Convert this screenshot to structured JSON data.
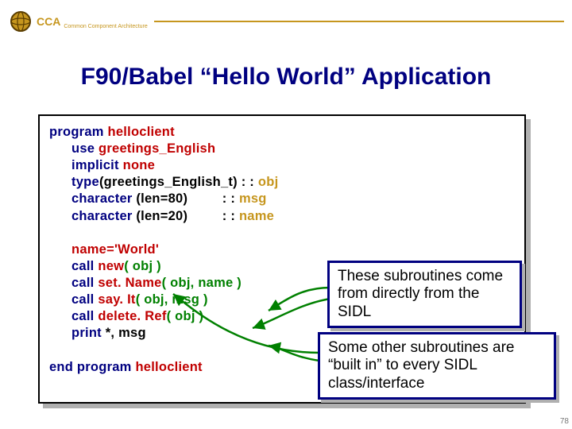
{
  "header": {
    "abbrev": "CCA",
    "subtitle": "Common Component Architecture"
  },
  "title": "F90/Babel  “Hello World” Application",
  "code": {
    "l1": {
      "kw": "program",
      "id": "helloclient"
    },
    "l2": {
      "kw": "use",
      "id": "greetings_English"
    },
    "l3": {
      "kw": "implicit",
      "id": "none"
    },
    "l4": {
      "kw": "type",
      "p1": "(greetings_English_t)",
      "sep": " : :",
      "ty": "obj"
    },
    "l5": {
      "kw": "character",
      "p1": "(len=80)",
      "sep": " : :",
      "ty": "msg"
    },
    "l6": {
      "kw": "character",
      "p1": "(len=20)",
      "sep": " : :",
      "ty": "name"
    },
    "l7": {
      "id": "name='World'"
    },
    "l8": {
      "kw": "call",
      "fn": "new",
      "args": "( obj )"
    },
    "l9": {
      "kw": "call",
      "fn": "set. Name",
      "args": "( obj, name )"
    },
    "l10": {
      "kw": "call",
      "fn": "say. It",
      "args": "( obj, msg )"
    },
    "l11": {
      "kw": "call",
      "fn": "delete. Ref",
      "args": "( obj )"
    },
    "l12": {
      "kw": "print",
      "rest": "*, msg"
    },
    "l13": {
      "kw": "end program",
      "id": "helloclient"
    }
  },
  "callouts": {
    "c1": "These subroutines come from directly from the SIDL",
    "c2": "Some other subroutines are “built in” to every SIDL class/interface"
  },
  "pagenum": "78"
}
